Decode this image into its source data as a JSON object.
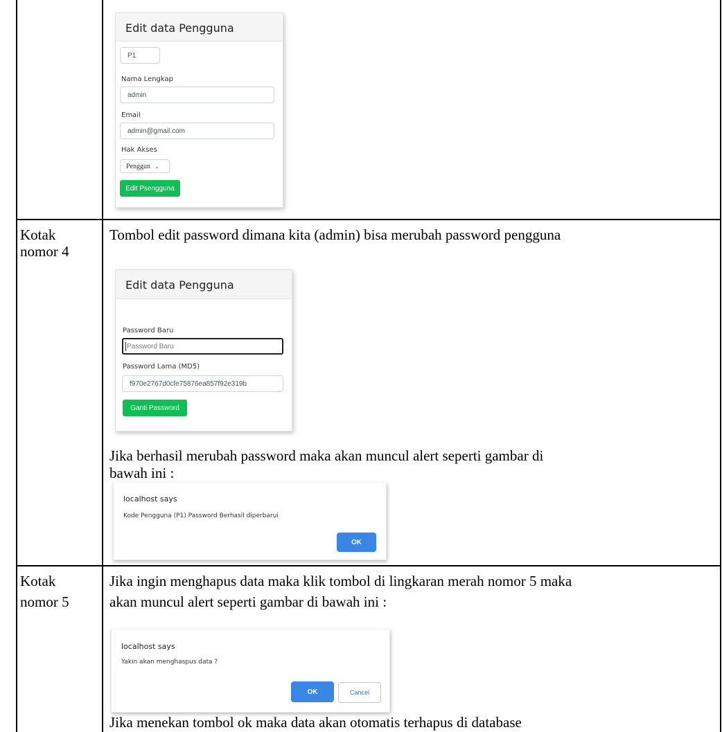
{
  "rows": [
    {
      "label": [],
      "form": {
        "title": "Edit data Pengguna",
        "code_value": "P1",
        "name_label": "Nama Lengkap",
        "name_value": "admin",
        "email_label": "Email",
        "email_value": "admin@gmail.com",
        "access_label": "Hak Akses",
        "access_value": "Penggun",
        "submit_label": "Edit Psengguna"
      }
    },
    {
      "label": [
        "Kotak",
        "nomor 4"
      ],
      "intro": "Tombol edit password dimana kita (admin) bisa merubah password pengguna",
      "form": {
        "title": "Edit data Pengguna",
        "new_password_label": "Password Baru",
        "new_password_placeholder": "Password Baru",
        "old_password_label": "Password Lama (MD5)",
        "old_password_value": "f970e2767d0cfe75876ea857f92e319b",
        "submit_label": "Ganti Password"
      },
      "after_text": [
        "Jika berhasil merubah password maka akan muncul alert seperti gambar di",
        "bawah ini :"
      ],
      "alert": {
        "title": "localhost says",
        "message": "Kode Pengguna (P1) Password Berhasil diperbarui",
        "ok_label": "OK"
      }
    },
    {
      "label": [
        "Kotak",
        "nomor 5"
      ],
      "intro": [
        "Jika ingin menghapus data maka klik tombol di lingkaran merah nomor 5 maka",
        "akan muncul alert seperti gambar di bawah ini :"
      ],
      "alert": {
        "title": "localhost says",
        "message": "Yakin akan menghaspus data ?",
        "ok_label": "OK",
        "cancel_label": "Cancel"
      },
      "after_text": "Jika menekan tombol ok maka data akan otomatis terhapus di database"
    }
  ],
  "colors": {
    "green_button": "#0fbf54",
    "blue_button": "#3a86e5",
    "table_border": "#000000"
  }
}
